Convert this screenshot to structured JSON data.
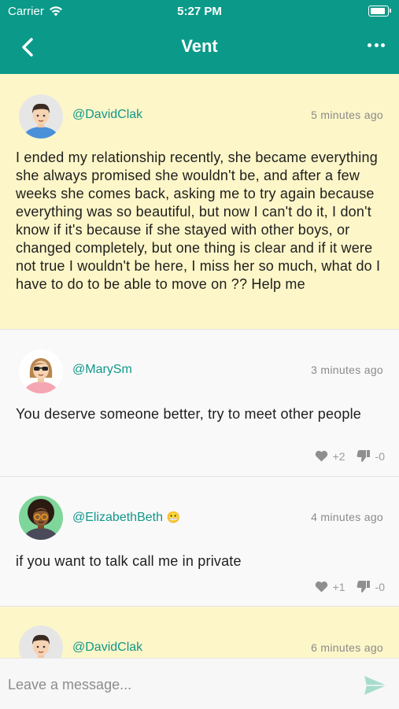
{
  "status_bar": {
    "carrier": "Carrier",
    "time": "5:27 PM",
    "battery_level": 0.95
  },
  "nav": {
    "title": "Vent",
    "back_icon": "chevron-left-icon",
    "more_icon": "more-horizontal-icon"
  },
  "posts": [
    {
      "username": "@DavidClak",
      "time": "5 minutes ago",
      "text": "I ended my relationship recently, she became everything she always promised she wouldn't be, and after a few weeks she comes back, asking me to try again because everything was so beautiful, but now I can't do it, I don't know if it's because if she stayed with other boys, or changed completely, but one thing is clear and if it were not true I wouldn't be here, I miss her so much, what do I have to do to be able to move on ?? Help me"
    },
    {
      "username": "@MarySm",
      "time": "3 minutes ago",
      "text": "You deserve someone better, try to meet other people",
      "likes": "+2",
      "dislikes": "-0"
    },
    {
      "username": "@ElizabethBeth",
      "emoji": "😬",
      "time": "4 minutes ago",
      "text": "if you want to talk call me in private",
      "likes": "+1",
      "dislikes": "-0"
    },
    {
      "username": "@DavidClak",
      "time": "6 minutes ago"
    }
  ],
  "composer": {
    "placeholder": "Leave a message...",
    "send_icon": "send-icon"
  },
  "colors": {
    "header": "#0b9a8a",
    "username": "#11978a",
    "highlight": "#fdf6c8"
  }
}
